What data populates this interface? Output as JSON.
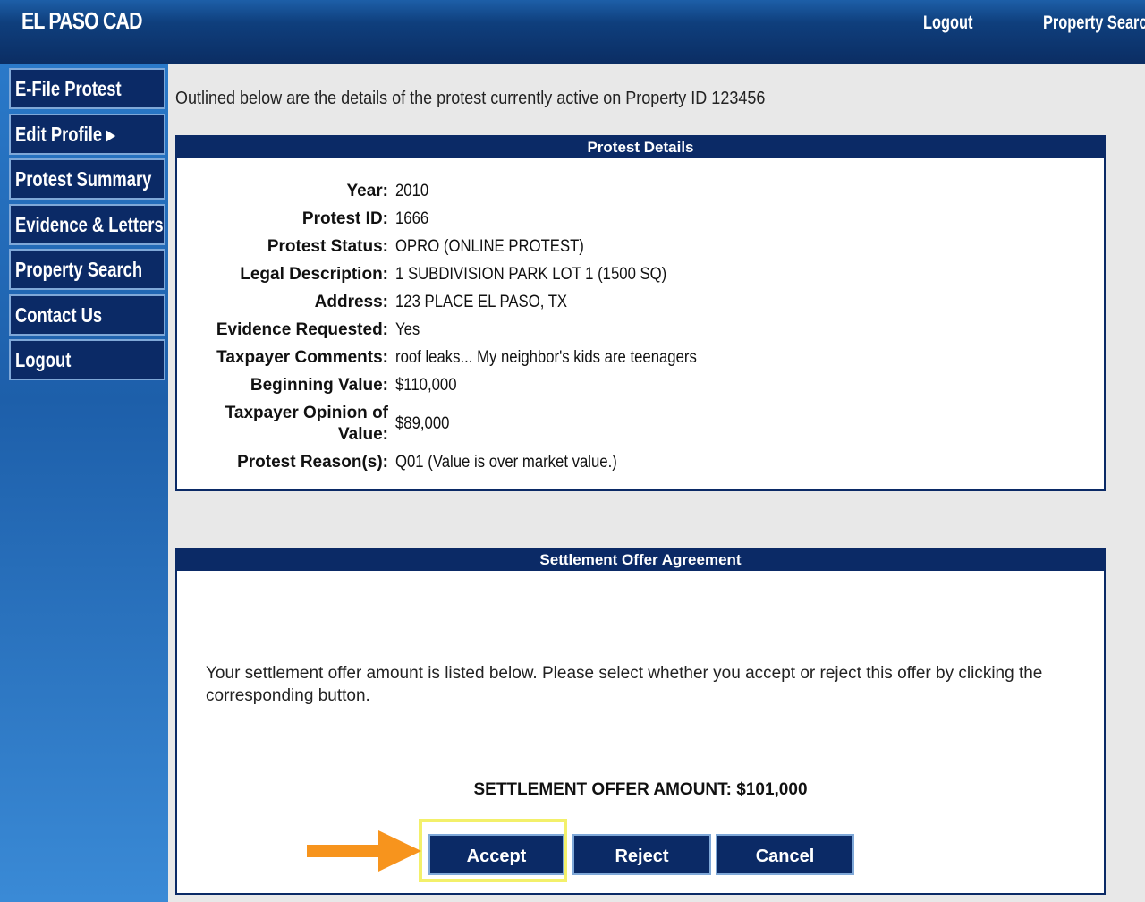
{
  "header": {
    "brand": "EL PASO CAD",
    "logout": "Logout",
    "property_search": "Property Search"
  },
  "nav": [
    {
      "label": "E-File Protest"
    },
    {
      "label": "Edit Profile ▸"
    },
    {
      "label": "Protest Summary"
    },
    {
      "label": "Evidence & Letters"
    },
    {
      "label": "Property Search"
    },
    {
      "label": "Contact Us"
    },
    {
      "label": "Logout"
    }
  ],
  "intro": "Outlined below are the details of the protest currently active on Property ID 123456",
  "details": {
    "title": "Protest Details",
    "rows": [
      {
        "label": "Year:",
        "value": "2010"
      },
      {
        "label": "Protest ID:",
        "value": "1666"
      },
      {
        "label": "Protest Status:",
        "value": "OPRO (ONLINE PROTEST)"
      },
      {
        "label": "Legal Description:",
        "value": "1 SUBDIVISION PARK LOT 1 (1500 SQ)"
      },
      {
        "label": "Address:",
        "value": "123 PLACE EL PASO, TX"
      },
      {
        "label": "Evidence Requested:",
        "value": "Yes"
      },
      {
        "label": "Taxpayer Comments:",
        "value": "roof leaks... My neighbor's kids are teenagers"
      },
      {
        "label": "Beginning Value:",
        "value": "$110,000"
      },
      {
        "label": "Taxpayer Opinion of",
        "label2": "Value:",
        "value": "$89,000"
      },
      {
        "label": "Protest Reason(s):",
        "value": "Q01 (Value is over market value.)"
      }
    ]
  },
  "settlement": {
    "title": "Settlement Offer Agreement",
    "message": "Your settlement offer amount is listed below. Please select whether you accept or reject this offer by clicking the corresponding button.",
    "offer": "SETTLEMENT OFFER AMOUNT: $101,000",
    "accept": "Accept",
    "reject": "Reject",
    "cancel": "Cancel"
  },
  "colors": {
    "nav_bg": "#0b2a66",
    "highlight": "#f3f06a",
    "arrow": "#f7941d"
  }
}
